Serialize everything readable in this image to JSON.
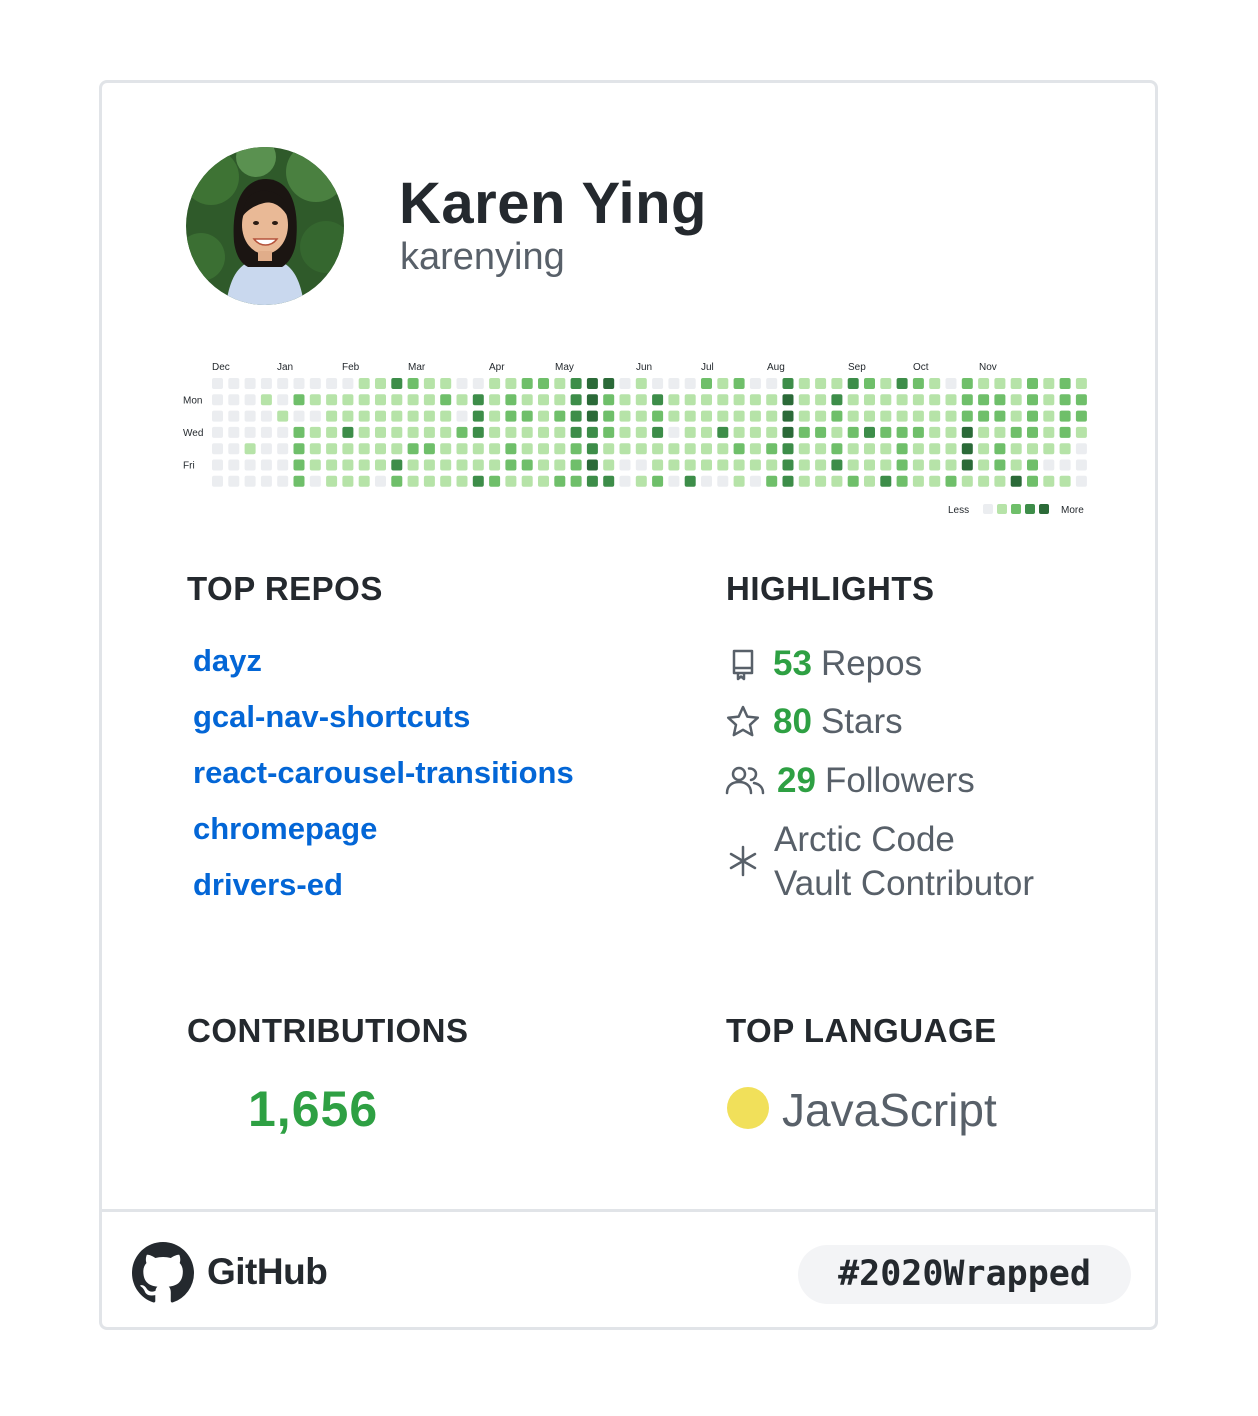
{
  "profile": {
    "name": "Karen Ying",
    "login": "karenying"
  },
  "contribution_graph": {
    "months": [
      "Dec",
      "Jan",
      "Feb",
      "Mar",
      "Apr",
      "May",
      "Jun",
      "Jul",
      "Aug",
      "Sep",
      "Oct",
      "Nov"
    ],
    "days": [
      "Mon",
      "Wed",
      "Fri"
    ],
    "legend_less": "Less",
    "legend_more": "More",
    "colors": [
      "#ebedf0",
      "#b6e3a8",
      "#6fbf6a",
      "#3d8d49",
      "#2b6a38"
    ],
    "weeks": [
      [
        0,
        0,
        0,
        0,
        0,
        0,
        0
      ],
      [
        0,
        0,
        0,
        0,
        0,
        0,
        0
      ],
      [
        0,
        0,
        0,
        0,
        1,
        0,
        0
      ],
      [
        0,
        1,
        0,
        0,
        0,
        0,
        0
      ],
      [
        0,
        0,
        1,
        0,
        0,
        0,
        0
      ],
      [
        0,
        2,
        0,
        2,
        2,
        2,
        2
      ],
      [
        0,
        1,
        0,
        1,
        1,
        1,
        0
      ],
      [
        0,
        1,
        1,
        1,
        1,
        1,
        1
      ],
      [
        0,
        1,
        1,
        3,
        1,
        1,
        1
      ],
      [
        1,
        1,
        1,
        1,
        1,
        1,
        1
      ],
      [
        1,
        1,
        1,
        1,
        1,
        1,
        0
      ],
      [
        3,
        1,
        1,
        1,
        1,
        3,
        2
      ],
      [
        2,
        1,
        1,
        1,
        2,
        1,
        1
      ],
      [
        1,
        1,
        1,
        1,
        2,
        1,
        1
      ],
      [
        1,
        2,
        1,
        1,
        1,
        1,
        1
      ],
      [
        0,
        1,
        0,
        2,
        1,
        1,
        1
      ],
      [
        0,
        3,
        3,
        3,
        1,
        1,
        3
      ],
      [
        1,
        1,
        1,
        1,
        1,
        1,
        2
      ],
      [
        1,
        2,
        2,
        1,
        2,
        2,
        1
      ],
      [
        2,
        1,
        2,
        1,
        1,
        2,
        1
      ],
      [
        2,
        1,
        1,
        1,
        1,
        1,
        1
      ],
      [
        1,
        1,
        2,
        1,
        1,
        1,
        2
      ],
      [
        3,
        3,
        3,
        3,
        2,
        2,
        2
      ],
      [
        4,
        4,
        4,
        3,
        3,
        4,
        3
      ],
      [
        4,
        2,
        2,
        2,
        1,
        1,
        3
      ],
      [
        0,
        1,
        1,
        1,
        1,
        0,
        0
      ],
      [
        1,
        1,
        1,
        1,
        1,
        0,
        1
      ],
      [
        0,
        3,
        2,
        3,
        1,
        1,
        2
      ],
      [
        0,
        1,
        1,
        0,
        1,
        1,
        0
      ],
      [
        0,
        1,
        1,
        1,
        1,
        1,
        3
      ],
      [
        2,
        1,
        1,
        1,
        1,
        1,
        0
      ],
      [
        1,
        1,
        1,
        3,
        1,
        1,
        0
      ],
      [
        2,
        1,
        1,
        1,
        2,
        1,
        1
      ],
      [
        0,
        1,
        1,
        1,
        1,
        1,
        0
      ],
      [
        0,
        1,
        1,
        1,
        2,
        1,
        2
      ],
      [
        3,
        4,
        4,
        4,
        3,
        3,
        3
      ],
      [
        1,
        1,
        1,
        2,
        1,
        1,
        1
      ],
      [
        1,
        1,
        1,
        2,
        1,
        1,
        1
      ],
      [
        1,
        3,
        2,
        1,
        2,
        3,
        1
      ],
      [
        3,
        1,
        1,
        2,
        1,
        1,
        2
      ],
      [
        2,
        1,
        1,
        3,
        1,
        1,
        1
      ],
      [
        1,
        1,
        1,
        2,
        1,
        1,
        3
      ],
      [
        3,
        1,
        1,
        2,
        2,
        2,
        2
      ],
      [
        2,
        1,
        1,
        2,
        1,
        1,
        1
      ],
      [
        1,
        1,
        1,
        1,
        1,
        1,
        1
      ],
      [
        0,
        1,
        1,
        1,
        1,
        1,
        2
      ],
      [
        2,
        2,
        2,
        4,
        4,
        4,
        1
      ],
      [
        1,
        2,
        2,
        1,
        1,
        1,
        1
      ],
      [
        1,
        2,
        2,
        1,
        2,
        2,
        1
      ],
      [
        1,
        1,
        1,
        2,
        1,
        1,
        4
      ],
      [
        2,
        2,
        2,
        2,
        1,
        2,
        2
      ],
      [
        1,
        1,
        1,
        1,
        1,
        0,
        1
      ],
      [
        2,
        2,
        2,
        2,
        1,
        0,
        1
      ],
      [
        1,
        2,
        2,
        1,
        0,
        0,
        0
      ]
    ]
  },
  "top_repos": {
    "title": "TOP REPOS",
    "items": [
      "dayz",
      "gcal-nav-shortcuts",
      "react-carousel-transitions",
      "chromepage",
      "drivers-ed"
    ]
  },
  "highlights": {
    "title": "HIGHLIGHTS",
    "repos": {
      "count": "53",
      "label": "Repos",
      "icon": "repo-icon"
    },
    "stars": {
      "count": "80",
      "label": "Stars",
      "icon": "star-icon"
    },
    "followers": {
      "count": "29",
      "label": "Followers",
      "icon": "people-icon"
    },
    "badge": {
      "line1": "Arctic Code",
      "line2": "Vault Contributor",
      "icon": "snowflake-icon"
    }
  },
  "contributions": {
    "title": "CONTRIBUTIONS",
    "count": "1,656"
  },
  "top_language": {
    "title": "TOP LANGUAGE",
    "name": "JavaScript",
    "color": "#f1e05a"
  },
  "footer": {
    "brand": "GitHub",
    "hashtag": "#2020Wrapped"
  }
}
